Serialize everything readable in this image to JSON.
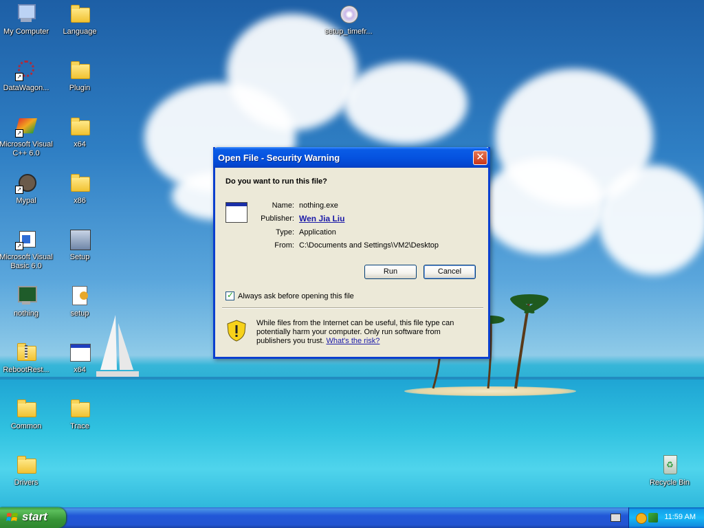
{
  "desktop": {
    "icons": [
      {
        "label": "My Computer",
        "icon": "my-computer-icon"
      },
      {
        "label": "Language",
        "icon": "folder-icon"
      },
      {
        "label": "setup_timefr...",
        "icon": "setup-cd-icon"
      },
      {
        "label": "DataWagon...",
        "icon": "datawagon-icon"
      },
      {
        "label": "Plugin",
        "icon": "folder-icon"
      },
      {
        "label": "Microsoft Visual C++ 6.0",
        "icon": "visual-cpp-icon"
      },
      {
        "label": "x64",
        "icon": "folder-icon"
      },
      {
        "label": "Mypal",
        "icon": "mypal-icon"
      },
      {
        "label": "x86",
        "icon": "folder-icon"
      },
      {
        "label": "Microsoft Visual Basic 6.0",
        "icon": "visual-basic-icon"
      },
      {
        "label": "Setup",
        "icon": "setup-icon"
      },
      {
        "label": "nothing",
        "icon": "nothing-app-icon"
      },
      {
        "label": "setup",
        "icon": "setup-config-icon"
      },
      {
        "label": "RebootRest...",
        "icon": "zip-folder-icon"
      },
      {
        "label": "x64",
        "icon": "app-window-icon"
      },
      {
        "label": "Common",
        "icon": "folder-icon"
      },
      {
        "label": "Trace",
        "icon": "folder-icon"
      },
      {
        "label": "Drivers",
        "icon": "folder-icon"
      },
      {
        "label": "Recycle Bin",
        "icon": "recycle-bin-icon"
      }
    ]
  },
  "dialog": {
    "title": "Open File - Security Warning",
    "close_symbol": "✕",
    "question": "Do you want to run this file?",
    "name_label": "Name:",
    "name_value": "nothing.exe",
    "publisher_label": "Publisher:",
    "publisher_value": "Wen Jia Liu",
    "type_label": "Type:",
    "type_value": "Application",
    "from_label": "From:",
    "from_value": "C:\\Documents and Settings\\VM2\\Desktop",
    "run_label": "Run",
    "cancel_label": "Cancel",
    "checkbox_label": "Always ask before opening this file",
    "checkbox_checked": true,
    "warning_text": "While files from the Internet can be useful, this file type can potentially harm your computer. Only run software from publishers you trust.",
    "risk_link": "What's the risk?"
  },
  "taskbar": {
    "start_label": "start",
    "clock": "11:59 AM"
  },
  "colors": {
    "title_bar": "#0553e0",
    "dialog_bg": "#ece9d8",
    "start_button": "#379537",
    "taskbar": "#2254d1",
    "link": "#1b1aa8"
  }
}
